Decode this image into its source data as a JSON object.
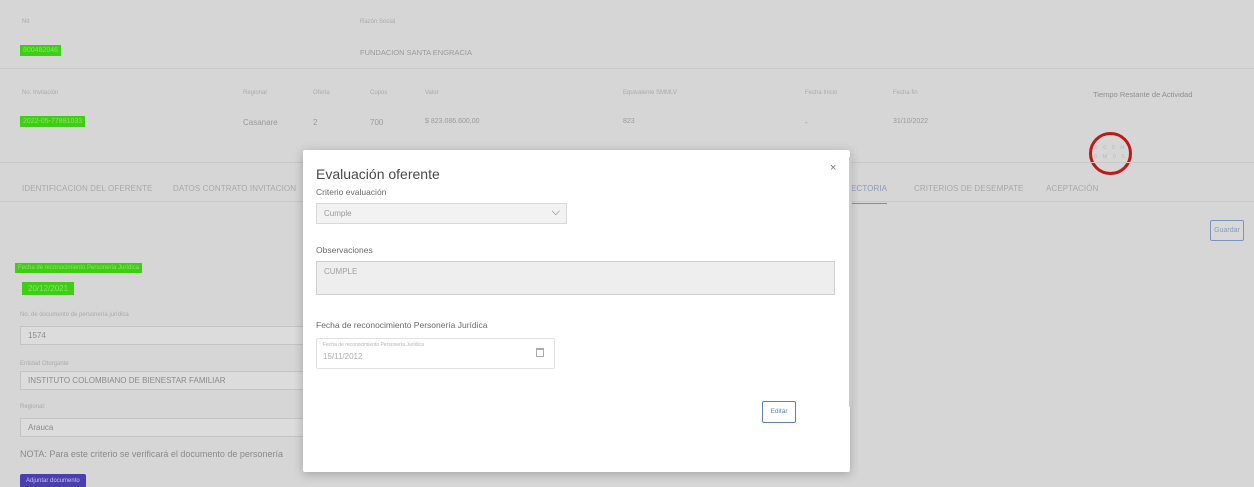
{
  "header": {
    "nit_label": "Nit",
    "nit_value": "800482046",
    "razon_label": "Razón Social",
    "razon_value": "FUNDACION SANTA ENGRACIA"
  },
  "info": {
    "labels": [
      "No. Invitación",
      "Regional",
      "Oferta",
      "Cupos",
      "Valor",
      "Equivalente SMMLV",
      "Fecha Inicio",
      "Fecha fin"
    ],
    "invitacion": "2022-05-77881033",
    "regional": "Casanare",
    "oferta": "2",
    "cupos": "700",
    "valor": "$ 823.086.600,00",
    "smmlv": "823",
    "fecha_inicio": "-",
    "fecha_fin": "31/10/2022"
  },
  "timer": {
    "title": "Tiempo Restante de Actividad",
    "line1": "0 0 0 H",
    "line2": "0 M 0 S"
  },
  "tabs": [
    "IDENTIFICACION DEL OFERENTE",
    "DATOS CONTRATO INVITACION",
    "ECTORIA",
    "CRITERIOS DE DESEMPATE",
    "ACEPTACIÓN"
  ],
  "form": {
    "guardar": "Guardar",
    "fecha_label": "Fecha de reconocimiento Personería Jurídica",
    "fecha_value": "20/12/2021",
    "doc_label": "No. de documento de personería jurídica",
    "doc_value": "1574",
    "entidad_label": "Entidad Otorgante",
    "entidad_value": "INSTITUTO COLOMBIANO DE BIENESTAR FAMILIAR",
    "regional_label": "Regional:",
    "regional_value": "Arauca",
    "nota": "NOTA: Para este criterio se verificará el documento de personería",
    "adjuntar": "Adjuntar documento"
  },
  "modal": {
    "title": "Evaluación oferente",
    "close": "×",
    "criterio_label": "Criterio evaluación",
    "criterio_value": "Cumple",
    "observaciones_label": "Observaciones",
    "observaciones_value": "CUMPLE",
    "fecha_label": "Fecha de reconocimiento Personería Jurídica",
    "fecha_float": "Fecha de reconocimiento Personería Jurídica",
    "fecha_value": "15/11/2012",
    "editar": "Editar"
  }
}
